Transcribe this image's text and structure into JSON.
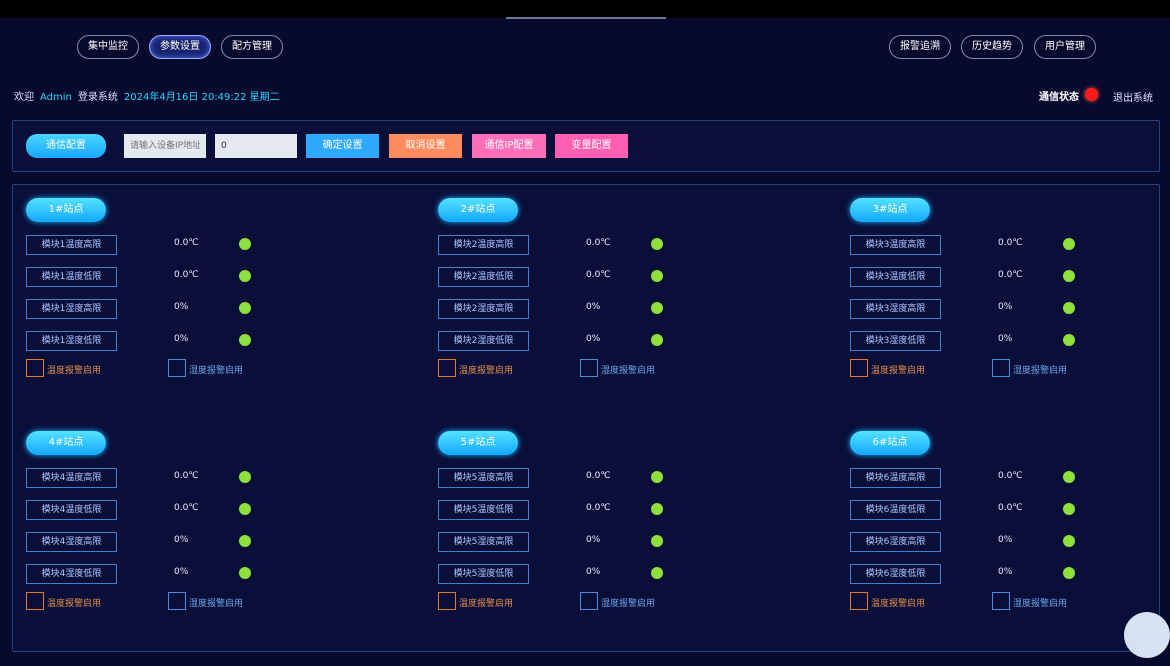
{
  "nav": {
    "left": [
      "集中监控",
      "参数设置",
      "配方管理"
    ],
    "right": [
      "报警追溯",
      "历史趋势",
      "用户管理"
    ]
  },
  "header": {
    "welcome": "欢迎",
    "user": "Admin",
    "login_text": "登录系统",
    "datetime": "2024年4月16日 20:49:22 星期二",
    "comm_status_label": "通信状态",
    "comm_status_color": "#ff1a1a",
    "logout": "退出系统"
  },
  "toolbar": {
    "comm_config": "通信配置",
    "ip_placeholder": "请输入设备IP地址",
    "number_value": "0",
    "confirm": "确定设置",
    "cancel": "取消设置",
    "comm_config2": "通信IP配置",
    "var_config": "变量配置"
  },
  "stations": [
    {
      "title": "1#站点",
      "rows": [
        {
          "label": "模块1温度高限",
          "value": "0.0℃"
        },
        {
          "label": "模块1温度低限",
          "value": "0.0℃"
        },
        {
          "label": "模块1湿度高限",
          "value": "0%"
        },
        {
          "label": "模块1湿度低限",
          "value": "0%"
        }
      ],
      "chk1": "温度报警启用",
      "chk2": "湿度报警启用"
    },
    {
      "title": "2#站点",
      "rows": [
        {
          "label": "模块2温度高限",
          "value": "0.0℃"
        },
        {
          "label": "模块2温度低限",
          "value": "0.0℃"
        },
        {
          "label": "模块2湿度高限",
          "value": "0%"
        },
        {
          "label": "模块2湿度低限",
          "value": "0%"
        }
      ],
      "chk1": "温度报警启用",
      "chk2": "湿度报警启用"
    },
    {
      "title": "3#站点",
      "rows": [
        {
          "label": "模块3温度高限",
          "value": "0.0℃"
        },
        {
          "label": "模块3温度低限",
          "value": "0.0℃"
        },
        {
          "label": "模块3湿度高限",
          "value": "0%"
        },
        {
          "label": "模块3湿度低限",
          "value": "0%"
        }
      ],
      "chk1": "温度报警启用",
      "chk2": "湿度报警启用"
    },
    {
      "title": "4#站点",
      "rows": [
        {
          "label": "模块4温度高限",
          "value": "0.0℃"
        },
        {
          "label": "模块4温度低限",
          "value": "0.0℃"
        },
        {
          "label": "模块4湿度高限",
          "value": "0%"
        },
        {
          "label": "模块4湿度低限",
          "value": "0%"
        }
      ],
      "chk1": "温度报警启用",
      "chk2": "湿度报警启用"
    },
    {
      "title": "5#站点",
      "rows": [
        {
          "label": "模块5温度高限",
          "value": "0.0℃"
        },
        {
          "label": "模块5温度低限",
          "value": "0.0℃"
        },
        {
          "label": "模块5湿度高限",
          "value": "0%"
        },
        {
          "label": "模块5湿度低限",
          "value": "0%"
        }
      ],
      "chk1": "温度报警启用",
      "chk2": "湿度报警启用"
    },
    {
      "title": "6#站点",
      "rows": [
        {
          "label": "模块6温度高限",
          "value": "0.0℃"
        },
        {
          "label": "模块6温度低限",
          "value": "0.0℃"
        },
        {
          "label": "模块6湿度高限",
          "value": "0%"
        },
        {
          "label": "模块6湿度低限",
          "value": "0%"
        }
      ],
      "chk1": "温度报警启用",
      "chk2": "湿度报警启用"
    }
  ]
}
